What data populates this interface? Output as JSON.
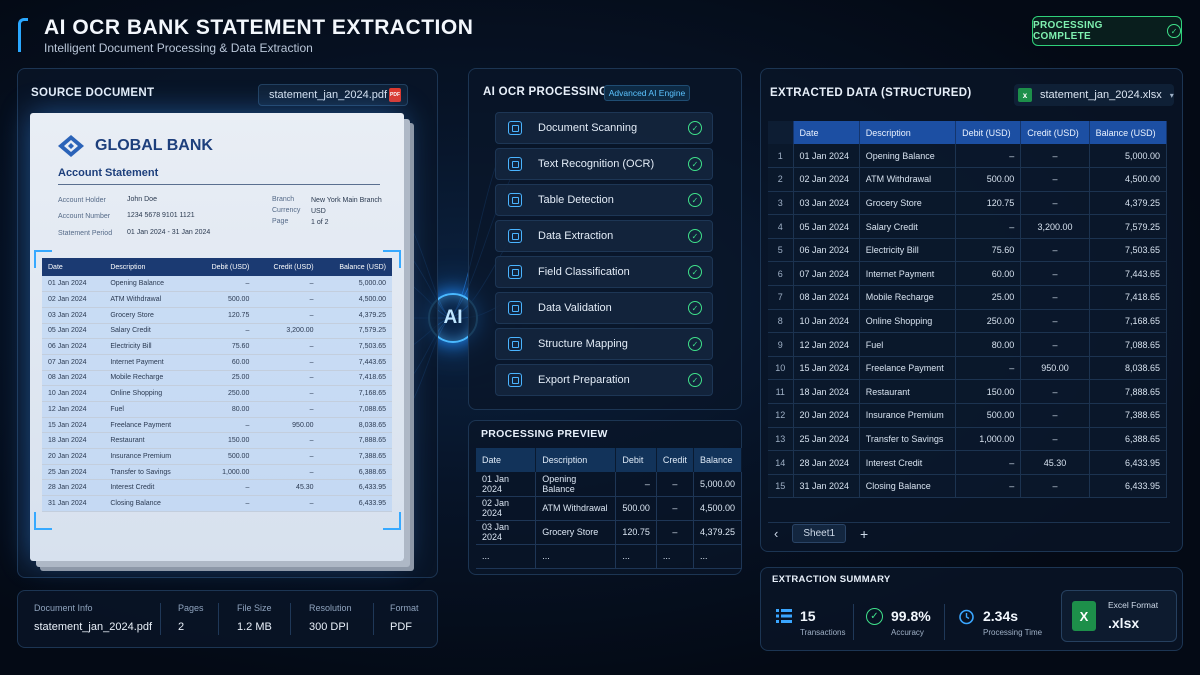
{
  "header": {
    "title": "AI OCR BANK STATEMENT EXTRACTION",
    "subtitle": "Intelligent Document Processing & Data Extraction",
    "status": "PROCESSING COMPLETE"
  },
  "colors": {
    "accent": "#2aa8ff",
    "success": "#3fe08a",
    "table_header": "#1c4fa3",
    "pdf": "#e0392d",
    "excel": "#1d8f4a"
  },
  "source": {
    "title": "SOURCE DOCUMENT",
    "file": "statement_jan_2024.pdf",
    "file_icon": "pdf-icon",
    "doc": {
      "bank": "GLOBAL BANK",
      "heading": "Account Statement",
      "holder_label": "Account Holder",
      "holder": "John Doe",
      "number_label": "Account Number",
      "number": "1234 5678 9101 1121",
      "period_label": "Statement Period",
      "period": "01 Jan 2024 - 31 Jan 2024",
      "branch_label": "Branch",
      "branch": "New York Main Branch",
      "currency_label": "Currency",
      "currency": "USD",
      "page_label": "Page",
      "page": "1 of 2",
      "columns": [
        "Date",
        "Description",
        "Debit (USD)",
        "Credit (USD)",
        "Balance (USD)"
      ],
      "rows": [
        [
          "01 Jan 2024",
          "Opening Balance",
          "–",
          "–",
          "5,000.00"
        ],
        [
          "02 Jan 2024",
          "ATM Withdrawal",
          "500.00",
          "–",
          "4,500.00"
        ],
        [
          "03 Jan 2024",
          "Grocery Store",
          "120.75",
          "–",
          "4,379.25"
        ],
        [
          "05 Jan 2024",
          "Salary Credit",
          "–",
          "3,200.00",
          "7,579.25"
        ],
        [
          "06 Jan 2024",
          "Electricity Bill",
          "75.60",
          "–",
          "7,503.65"
        ],
        [
          "07 Jan 2024",
          "Internet Payment",
          "60.00",
          "–",
          "7,443.65"
        ],
        [
          "08 Jan 2024",
          "Mobile Recharge",
          "25.00",
          "–",
          "7,418.65"
        ],
        [
          "10 Jan 2024",
          "Online Shopping",
          "250.00",
          "–",
          "7,168.65"
        ],
        [
          "12 Jan 2024",
          "Fuel",
          "80.00",
          "–",
          "7,088.65"
        ],
        [
          "15 Jan 2024",
          "Freelance Payment",
          "–",
          "950.00",
          "8,038.65"
        ],
        [
          "18 Jan 2024",
          "Restaurant",
          "150.00",
          "–",
          "7,888.65"
        ],
        [
          "20 Jan 2024",
          "Insurance Premium",
          "500.00",
          "–",
          "7,388.65"
        ],
        [
          "25 Jan 2024",
          "Transfer to Savings",
          "1,000.00",
          "–",
          "6,388.65"
        ],
        [
          "28 Jan 2024",
          "Interest Credit",
          "–",
          "45.30",
          "6,433.95"
        ],
        [
          "31 Jan 2024",
          "Closing Balance",
          "–",
          "–",
          "6,433.95"
        ]
      ]
    }
  },
  "doc_info": [
    {
      "label": "Document Info",
      "value": "statement_jan_2024.pdf"
    },
    {
      "label": "Pages",
      "value": "2"
    },
    {
      "label": "File Size",
      "value": "1.2 MB"
    },
    {
      "label": "Resolution",
      "value": "300 DPI"
    },
    {
      "label": "Format",
      "value": "PDF"
    }
  ],
  "ai_badge": "AI",
  "processing": {
    "title": "AI OCR PROCESSING",
    "engine": "Advanced AI Engine",
    "steps": [
      {
        "label": "Document Scanning",
        "icon": "scan-icon",
        "done": true
      },
      {
        "label": "Text Recognition (OCR)",
        "icon": "text-recognition-icon",
        "done": true
      },
      {
        "label": "Table Detection",
        "icon": "table-icon",
        "done": true
      },
      {
        "label": "Data Extraction",
        "icon": "extract-icon",
        "done": true
      },
      {
        "label": "Field Classification",
        "icon": "classify-icon",
        "done": true
      },
      {
        "label": "Data Validation",
        "icon": "validate-icon",
        "done": true
      },
      {
        "label": "Structure Mapping",
        "icon": "structure-icon",
        "done": true
      },
      {
        "label": "Export Preparation",
        "icon": "export-icon",
        "done": true
      }
    ]
  },
  "preview": {
    "title": "PROCESSING PREVIEW",
    "columns": [
      "Date",
      "Description",
      "Debit",
      "Credit",
      "Balance"
    ],
    "rows": [
      [
        "01 Jan 2024",
        "Opening Balance",
        "–",
        "–",
        "5,000.00"
      ],
      [
        "02 Jan 2024",
        "ATM Withdrawal",
        "500.00",
        "–",
        "4,500.00"
      ],
      [
        "03 Jan 2024",
        "Grocery Store",
        "120.75",
        "–",
        "4,379.25"
      ],
      [
        "...",
        "...",
        "...",
        "...",
        "..."
      ]
    ]
  },
  "extracted": {
    "title": "EXTRACTED DATA (STRUCTURED)",
    "file": "statement_jan_2024.xlsx",
    "file_icon": "excel-icon",
    "columns": [
      "Date",
      "Description",
      "Debit (USD)",
      "Credit (USD)",
      "Balance (USD)"
    ],
    "rows": [
      [
        "1",
        "01 Jan 2024",
        "Opening Balance",
        "–",
        "–",
        "5,000.00"
      ],
      [
        "2",
        "02 Jan 2024",
        "ATM Withdrawal",
        "500.00",
        "–",
        "4,500.00"
      ],
      [
        "3",
        "03 Jan 2024",
        "Grocery Store",
        "120.75",
        "–",
        "4,379.25"
      ],
      [
        "4",
        "05 Jan 2024",
        "Salary Credit",
        "–",
        "3,200.00",
        "7,579.25"
      ],
      [
        "5",
        "06 Jan 2024",
        "Electricity Bill",
        "75.60",
        "–",
        "7,503.65"
      ],
      [
        "6",
        "07 Jan 2024",
        "Internet Payment",
        "60.00",
        "–",
        "7,443.65"
      ],
      [
        "7",
        "08 Jan 2024",
        "Mobile Recharge",
        "25.00",
        "–",
        "7,418.65"
      ],
      [
        "8",
        "10 Jan 2024",
        "Online Shopping",
        "250.00",
        "–",
        "7,168.65"
      ],
      [
        "9",
        "12 Jan 2024",
        "Fuel",
        "80.00",
        "–",
        "7,088.65"
      ],
      [
        "10",
        "15 Jan 2024",
        "Freelance Payment",
        "–",
        "950.00",
        "8,038.65"
      ],
      [
        "11",
        "18 Jan 2024",
        "Restaurant",
        "150.00",
        "–",
        "7,888.65"
      ],
      [
        "12",
        "20 Jan 2024",
        "Insurance Premium",
        "500.00",
        "–",
        "7,388.65"
      ],
      [
        "13",
        "25 Jan 2024",
        "Transfer to Savings",
        "1,000.00",
        "–",
        "6,388.65"
      ],
      [
        "14",
        "28 Jan 2024",
        "Interest Credit",
        "–",
        "45.30",
        "6,433.95"
      ],
      [
        "15",
        "31 Jan 2024",
        "Closing Balance",
        "–",
        "–",
        "6,433.95"
      ]
    ],
    "sheet": "Sheet1",
    "add_sheet": "+",
    "prev_sheet": "‹"
  },
  "summary": {
    "title": "EXTRACTION SUMMARY",
    "metrics": [
      {
        "value": "15",
        "label": "Transactions",
        "icon": "list-icon"
      },
      {
        "value": "99.8%",
        "label": "Accuracy",
        "icon": "check-circle-icon"
      },
      {
        "value": "2.34s",
        "label": "Processing Time",
        "icon": "timer-icon"
      }
    ],
    "format_label": "Excel Format",
    "format_value": ".xlsx"
  }
}
